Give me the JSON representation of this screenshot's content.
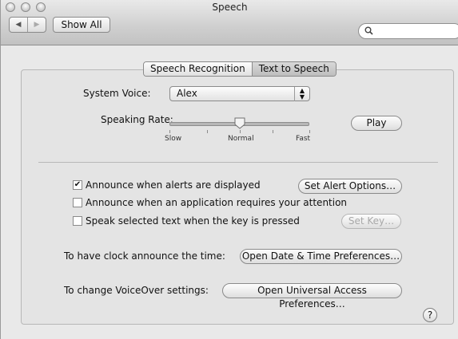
{
  "window": {
    "title": "Speech"
  },
  "toolbar": {
    "show_all_label": "Show All",
    "search_placeholder": ""
  },
  "tabs": [
    {
      "label": "Speech Recognition"
    },
    {
      "label": "Text to Speech"
    }
  ],
  "voice": {
    "label": "System Voice:",
    "value": "Alex"
  },
  "rate": {
    "label": "Speaking Rate:",
    "value_fraction": 0.5,
    "slow": "Slow",
    "normal": "Normal",
    "fast": "Fast",
    "play_label": "Play"
  },
  "options": {
    "announce_alerts": {
      "label": "Announce when alerts are displayed",
      "checked": true
    },
    "announce_attention": {
      "label": "Announce when an application requires your attention",
      "checked": false
    },
    "speak_selected": {
      "label": "Speak selected text when the key is pressed",
      "checked": false
    },
    "set_alert_options": "Set Alert Options…",
    "set_key": "Set Key…"
  },
  "clock": {
    "label": "To have clock announce the time:",
    "button": "Open Date & Time Preferences…"
  },
  "voiceover": {
    "label": "To change VoiceOver settings:",
    "button": "Open Universal Access Preferences…"
  },
  "help": {
    "label": "?"
  }
}
